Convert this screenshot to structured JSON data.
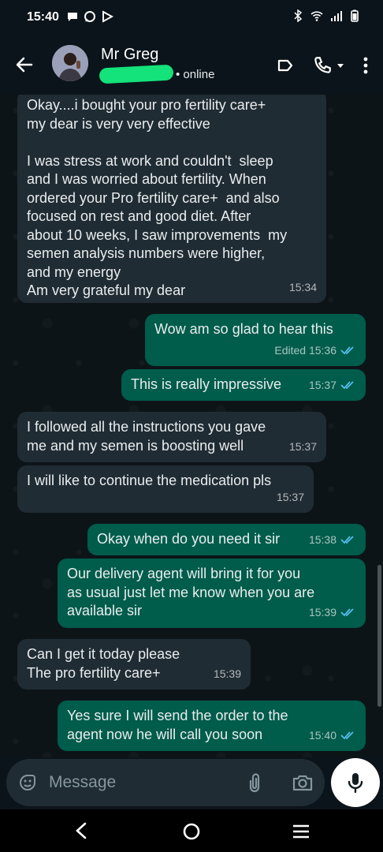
{
  "status_bar": {
    "time": "15:40"
  },
  "header": {
    "name": "Mr Greg",
    "status": "• online"
  },
  "messages": [
    {
      "dir": "in",
      "text": "Okay....i bought your pro fertility care+\nmy dear is very very effective\n\nI was stress at work and couldn't  sleep\nand I was worried about fertility. When\nordered your Pro fertility care+  and also\nfocused on rest and good diet. After\nabout 10 weeks, I saw improvements  my\nsemen analysis numbers were higher,\nand my energy\nAm very grateful my dear",
      "time": "15:34"
    },
    {
      "dir": "out",
      "text": "Wow am so glad to hear this",
      "time": "Edited 15:36"
    },
    {
      "dir": "out",
      "text": "This is really impressive",
      "time": "15:37"
    },
    {
      "dir": "in",
      "text": "I followed all the instructions you gave\nme and my semen is boosting well",
      "time": "15:37"
    },
    {
      "dir": "in",
      "text": "I will like to continue the medication pls",
      "time": "15:37"
    },
    {
      "dir": "out",
      "text": "Okay when do you need it sir",
      "time": "15:38"
    },
    {
      "dir": "out",
      "text": "Our delivery agent will bring it for you\nas usual just let me know when you are\navailable sir",
      "time": "15:39"
    },
    {
      "dir": "in",
      "text": "Can I get it today please\nThe pro fertility care+",
      "time": "15:39"
    },
    {
      "dir": "out",
      "text": "Yes sure I will send the order to the\nagent now he will call you soon",
      "time": "15:40"
    }
  ],
  "composer": {
    "placeholder": "Message"
  },
  "colors": {
    "incoming": "#202c33",
    "outgoing": "#005c4b",
    "read_ticks": "#53bdeb",
    "accent": "#14e27a"
  }
}
